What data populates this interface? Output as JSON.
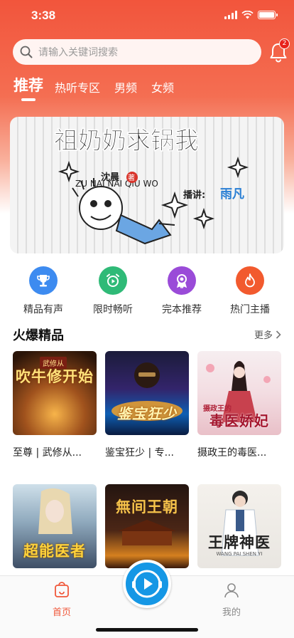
{
  "status_bar": {
    "time": "3:38"
  },
  "search": {
    "placeholder": "请输入关键词搜索"
  },
  "notifications": {
    "badge_count": "2"
  },
  "tabs": [
    {
      "label": "推荐",
      "active": true
    },
    {
      "label": "热听专区"
    },
    {
      "label": "男频"
    },
    {
      "label": "女频"
    }
  ],
  "banner": {
    "title": "祖奶奶求锅我",
    "author": "沈晨",
    "author_suffix": "著",
    "pinyin": "ZU NAI NAI QIU WO",
    "narrator_label": "播讲:",
    "narrator": "雨凡"
  },
  "quick_entries": [
    {
      "label": "精品有声",
      "icon": "trophy-icon",
      "color": "#3d8bf0"
    },
    {
      "label": "限时畅听",
      "icon": "alarm-clock-icon",
      "color": "#2fba77"
    },
    {
      "label": "完本推荐",
      "icon": "medal-icon",
      "color": "#9a4bd8"
    },
    {
      "label": "热门主播",
      "icon": "flame-icon",
      "color": "#f25a2e"
    }
  ],
  "section": {
    "title": "火爆精品",
    "more_label": "更多"
  },
  "books": [
    {
      "name": "至尊 | 武修从...",
      "cover_title": "吹牛修开始",
      "cover_tag": "武修从"
    },
    {
      "name": "鉴宝狂少 | 专...",
      "cover_title": "鉴宝狂少"
    },
    {
      "name": "摄政王的毒医...",
      "cover_title": "毒医娇妃",
      "cover_tag": "摄政王的"
    },
    {
      "name": "",
      "cover_title": "超能医者"
    },
    {
      "name": "",
      "cover_title": "無间王朝"
    },
    {
      "name": "",
      "cover_title": "王牌神医",
      "cover_sub": "WANG PAI SHEN YI"
    }
  ],
  "bottom_nav": {
    "home_label": "首页",
    "mine_label": "我的",
    "accent": "#f0583b"
  }
}
